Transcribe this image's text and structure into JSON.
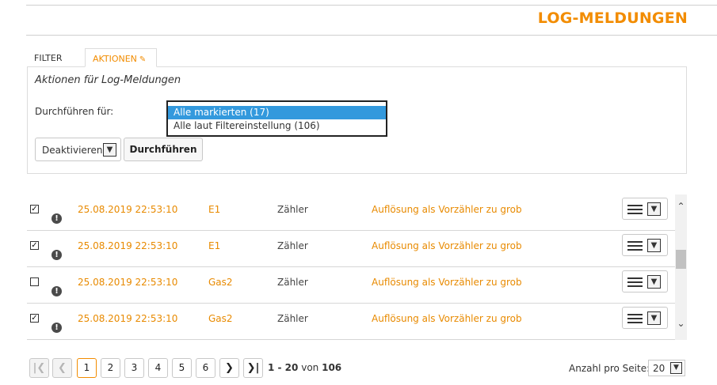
{
  "header": {
    "title": "LOG-MELDUNGEN"
  },
  "tabs": [
    {
      "label": "FILTER",
      "active": false
    },
    {
      "label": "AKTIONEN",
      "active": true,
      "icon": "pin-icon"
    }
  ],
  "actions_panel": {
    "heading": "Aktionen für Log-Meldungen",
    "scope_label": "Durchführen für:",
    "scope_options": [
      "Alle markierten (17)",
      "Alle laut Filtereinstellung (106)"
    ],
    "scope_selected": "Alle markierten (17)",
    "action_select_value": "Deaktivieren",
    "run_button": "Durchführen"
  },
  "table": {
    "rows": [
      {
        "checked": true,
        "status_icon": "warning-icon",
        "date": "25.08.2019 22:53:10",
        "device": "E1",
        "type": "Zähler",
        "message": "Auflösung als Vorzähler zu grob"
      },
      {
        "checked": true,
        "status_icon": "warning-icon",
        "date": "25.08.2019 22:53:10",
        "device": "E1",
        "type": "Zähler",
        "message": "Auflösung als Vorzähler zu grob"
      },
      {
        "checked": false,
        "status_icon": "warning-icon",
        "date": "25.08.2019 22:53:10",
        "device": "Gas2",
        "type": "Zähler",
        "message": "Auflösung als Vorzähler zu grob"
      },
      {
        "checked": true,
        "status_icon": "warning-icon",
        "date": "25.08.2019 22:53:10",
        "device": "Gas2",
        "type": "Zähler",
        "message": "Auflösung als Vorzähler zu grob"
      }
    ]
  },
  "pagination": {
    "pages": [
      "1",
      "2",
      "3",
      "4",
      "5",
      "6"
    ],
    "current_page": "1",
    "range": "1 - 20",
    "of_label": "von",
    "total": "106",
    "per_page_label": "Anzahl pro Seite:",
    "per_page_value": "20"
  },
  "colors": {
    "accent": "#f28c00",
    "selection": "#3399dd"
  }
}
